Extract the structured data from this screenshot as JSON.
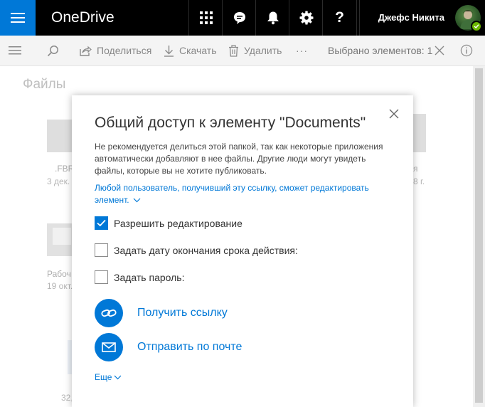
{
  "header": {
    "app_title": "OneDrive",
    "user_name": "Джефс Никита",
    "icons": [
      "app-launcher-icon",
      "waffle-grid-icon",
      "skype-chat-icon",
      "notifications-bell-icon",
      "settings-gear-icon",
      "help-question-icon"
    ],
    "help_label": "?"
  },
  "toolbar": {
    "share_label": "Поделиться",
    "download_label": "Скачать",
    "delete_label": "Удалить",
    "more_label": "···",
    "selected_label": "Выбрано элементов: 1"
  },
  "content": {
    "title": "Файлы",
    "tiles": [
      {
        "name": ".FBR",
        "date": "3 дек."
      },
      {
        "name": "я",
        "date": "8 г."
      },
      {
        "name": "Рабоч",
        "date": "19 окт."
      },
      {
        "name": "32,",
        "date": ""
      }
    ]
  },
  "dialog": {
    "title": "Общий доступ к элементу \"Documents\"",
    "description": "Не рекомендуется делиться этой папкой, так как некоторые приложения автоматически добавляют в нее файлы. Другие люди могут увидеть файлы, которые вы не хотите публиковать.",
    "permission": "Любой пользователь, получивший эту ссылку, сможет редактировать элемент.",
    "options": [
      {
        "label": "Разрешить редактирование",
        "checked": true
      },
      {
        "label": "Задать дату окончания срока действия:",
        "checked": false
      },
      {
        "label": "Задать пароль:",
        "checked": false
      }
    ],
    "get_link_label": "Получить ссылку",
    "email_label": "Отправить по почте",
    "more_label": "Еще"
  },
  "colors": {
    "accent": "#0078d7",
    "header_bg": "#000000",
    "command_bar_bg": "#f4f4f4",
    "presence": "#6bb700"
  }
}
